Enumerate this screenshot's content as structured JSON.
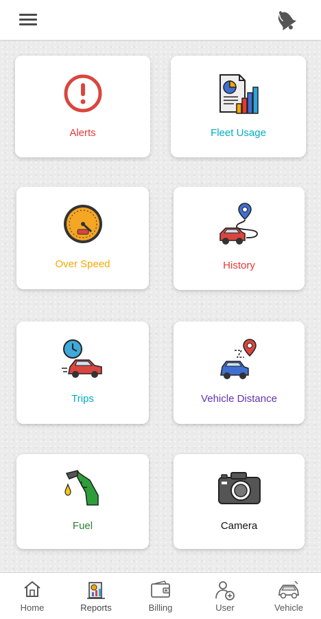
{
  "header": {
    "menu_icon": "hamburger-menu-icon",
    "notification_icon": "bell-icon"
  },
  "cards": [
    {
      "label": "Alerts",
      "color": "#e53935",
      "icon": "alert-icon"
    },
    {
      "label": "Fleet Usage",
      "color": "#00acc1",
      "icon": "report-chart-icon"
    },
    {
      "label": "Over Speed",
      "color": "#f2a900",
      "icon": "speedometer-icon"
    },
    {
      "label": "History",
      "color": "#e53935",
      "icon": "route-history-icon"
    },
    {
      "label": "Trips",
      "color": "#00acc1",
      "icon": "trip-clock-car-icon"
    },
    {
      "label": "Vehicle Distance",
      "color": "#5e35b1",
      "icon": "distance-car-icon"
    },
    {
      "label": "Fuel",
      "color": "#2e7d32",
      "icon": "fuel-nozzle-icon"
    },
    {
      "label": "Camera",
      "color": "#111111",
      "icon": "camera-icon"
    }
  ],
  "bottom_nav": [
    {
      "label": "Home",
      "icon": "home-icon"
    },
    {
      "label": "Reports",
      "icon": "reports-icon"
    },
    {
      "label": "Billing",
      "icon": "wallet-icon"
    },
    {
      "label": "User",
      "icon": "user-add-icon"
    },
    {
      "label": "Vehicle",
      "icon": "vehicle-icon"
    }
  ]
}
